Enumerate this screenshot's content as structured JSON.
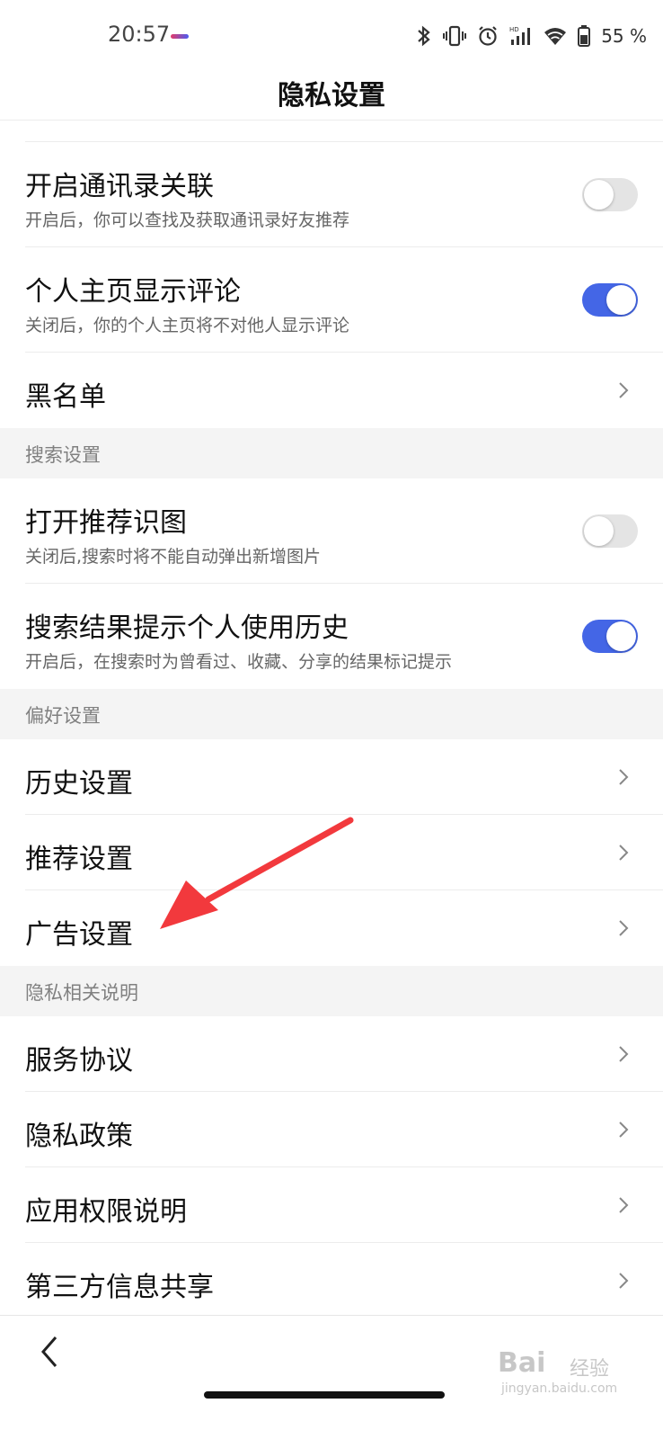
{
  "status_bar": {
    "time": "20:57",
    "battery_percent": "55 %",
    "icons": [
      "bluetooth-icon",
      "vibrate-icon",
      "alarm-icon",
      "signal-icon",
      "wifi-icon",
      "battery-icon"
    ]
  },
  "header": {
    "title": "隐私设置"
  },
  "sections": {
    "top": {
      "rows": [
        {
          "title": "开启通讯录关联",
          "subtitle": "开启后，你可以查找及获取通讯录好友推荐",
          "toggle_on": false
        },
        {
          "title": "个人主页显示评论",
          "subtitle": "关闭后，你的个人主页将不对他人显示评论",
          "toggle_on": true
        },
        {
          "title": "黑名单"
        }
      ]
    },
    "search": {
      "label": "搜索设置",
      "rows": [
        {
          "title": "打开推荐识图",
          "subtitle": "关闭后,搜索时将不能自动弹出新增图片",
          "toggle_on": false
        },
        {
          "title": "搜索结果提示个人使用历史",
          "subtitle": "开启后，在搜索时为曾看过、收藏、分享的结果标记提示",
          "toggle_on": true
        }
      ]
    },
    "preference": {
      "label": "偏好设置",
      "rows": [
        {
          "title": "历史设置"
        },
        {
          "title": "推荐设置"
        },
        {
          "title": "广告设置"
        }
      ]
    },
    "privacy_info": {
      "label": "隐私相关说明",
      "rows": [
        {
          "title": "服务协议"
        },
        {
          "title": "隐私政策"
        },
        {
          "title": "应用权限说明"
        },
        {
          "title": "第三方信息共享"
        }
      ]
    }
  },
  "colors": {
    "accent": "#4466e6",
    "annotation_arrow": "#f2393d",
    "section_bg": "#f4f4f4"
  },
  "watermark": {
    "brand": "Bai",
    "brand_cn": "经验",
    "url": "jingyan.baidu.com"
  }
}
